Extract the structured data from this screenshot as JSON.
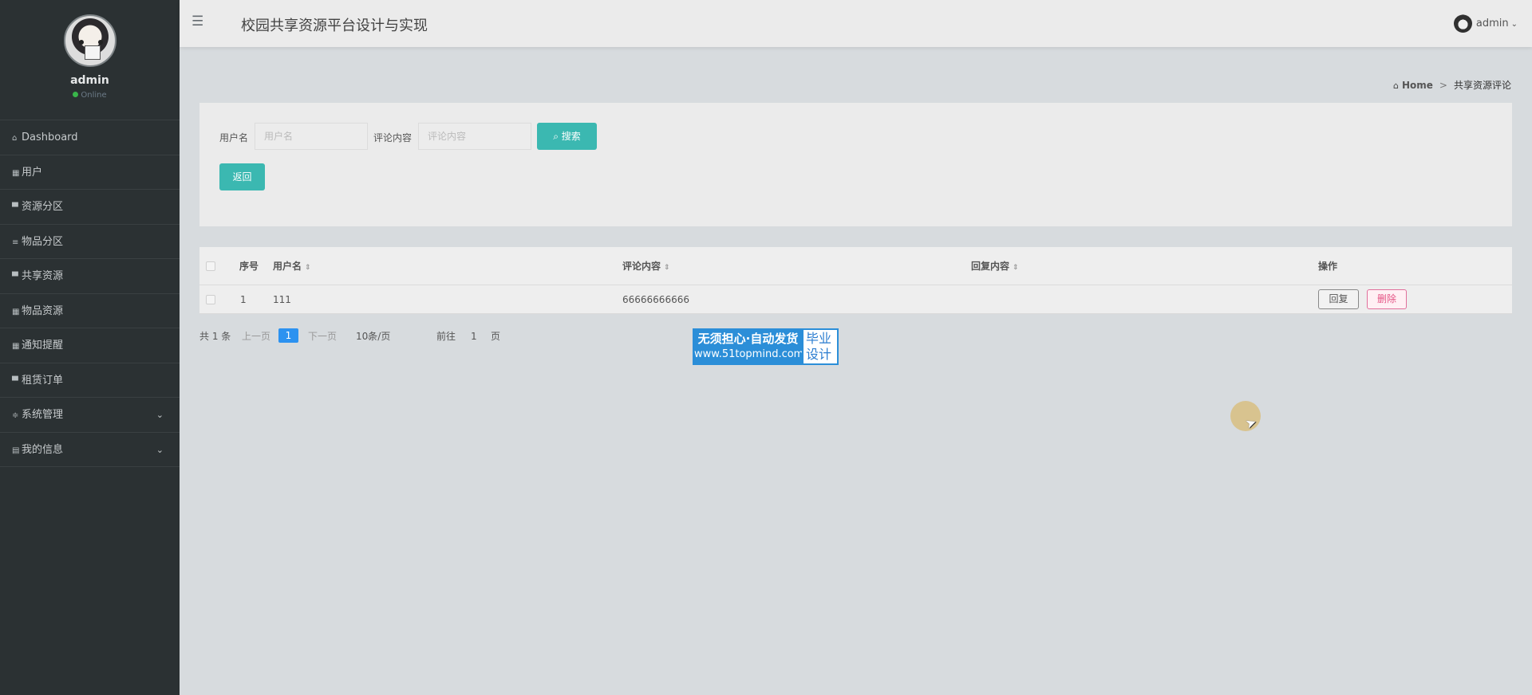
{
  "sidebar": {
    "profile_name": "admin",
    "status": "Online",
    "menu": [
      {
        "icon": "home-icon",
        "glyph": "⌂",
        "label": "Dashboard",
        "has_arrow": false
      },
      {
        "icon": "grid-icon",
        "glyph": "▦",
        "label": "用户",
        "has_arrow": false
      },
      {
        "icon": "comment-icon",
        "glyph": "▀",
        "label": "资源分区",
        "has_arrow": false
      },
      {
        "icon": "list-icon",
        "glyph": "≡",
        "label": "物品分区",
        "has_arrow": false
      },
      {
        "icon": "comment-icon",
        "glyph": "▀",
        "label": "共享资源",
        "has_arrow": false
      },
      {
        "icon": "grid-icon",
        "glyph": "▦",
        "label": "物品资源",
        "has_arrow": false
      },
      {
        "icon": "grid-icon",
        "glyph": "▦",
        "label": "通知提醒",
        "has_arrow": false
      },
      {
        "icon": "comment-icon",
        "glyph": "▀",
        "label": "租赁订单",
        "has_arrow": false
      },
      {
        "icon": "sliders-icon",
        "glyph": "≑",
        "label": "系统管理",
        "has_arrow": true
      },
      {
        "icon": "card-icon",
        "glyph": "▤",
        "label": "我的信息",
        "has_arrow": true
      }
    ],
    "arrow_glyph": "⌄"
  },
  "header": {
    "menu_glyph": "☰",
    "title": "校园共享资源平台设计与实现",
    "user": "admin",
    "caret": "⌄"
  },
  "breadcrumb": {
    "home": "Home",
    "separator": ">",
    "current": "共享资源评论"
  },
  "search": {
    "username_label": "用户名",
    "username_placeholder": "用户名",
    "comment_label": "评论内容",
    "comment_placeholder": "评论内容",
    "search_button": "搜索",
    "back_button": "返回"
  },
  "table": {
    "headers": [
      "序号",
      "用户名",
      "评论内容",
      "回复内容",
      "操作"
    ],
    "sort_glyph": "⇕",
    "rows": [
      {
        "index": "1",
        "username": "111",
        "comment": "66666666666",
        "reply": "",
        "actions": [
          "回复",
          "删除"
        ]
      }
    ]
  },
  "pagination": {
    "total": "共 1 条",
    "prev": "上一页",
    "current_page": "1",
    "next": "下一页",
    "page_size": "10条/页",
    "goto_label": "前往",
    "goto_value": "1",
    "page_suffix": "页"
  },
  "banner": {
    "left_title": "无须担心·自动发货",
    "left_site": "www.51topmind.com",
    "right_line1": "毕业",
    "right_line2": "设计"
  },
  "colors": {
    "sidebar": "#2b3133",
    "accent_teal": "#3bb8b1",
    "page_blue": "#2c92f0",
    "delete_pink": "#e55485"
  }
}
